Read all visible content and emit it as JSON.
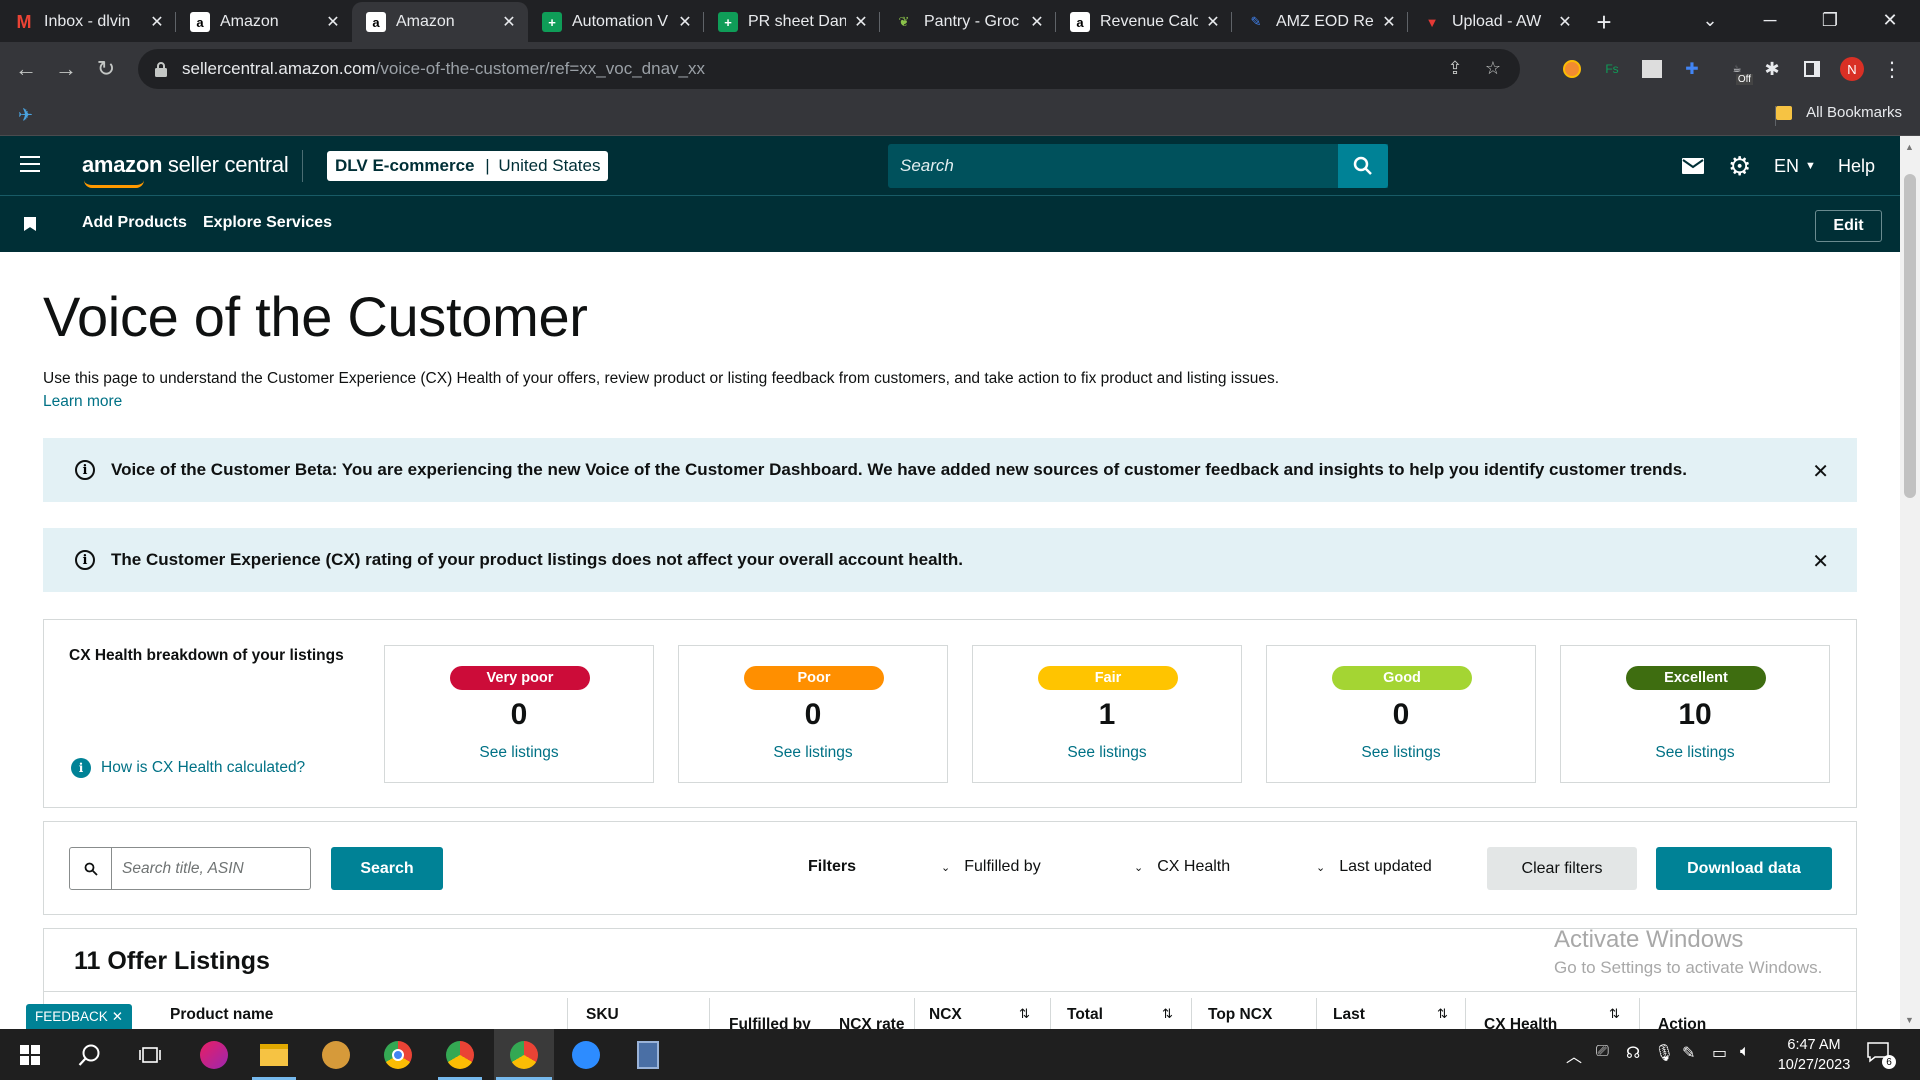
{
  "browser": {
    "tabs": [
      {
        "title": "Inbox - dlvin",
        "favicon": "gmail-icon",
        "active": false
      },
      {
        "title": "Amazon",
        "favicon": "amazon-icon",
        "active": false
      },
      {
        "title": "Amazon",
        "favicon": "amazon-icon",
        "active": true
      },
      {
        "title": "Automation V",
        "favicon": "sheets-icon",
        "active": false
      },
      {
        "title": "PR sheet Dan",
        "favicon": "sheets-icon",
        "active": false
      },
      {
        "title": "Pantry - Groc",
        "favicon": "pantry-icon",
        "active": false
      },
      {
        "title": "Revenue Calc",
        "favicon": "amazon-icon",
        "active": false
      },
      {
        "title": "AMZ EOD Re",
        "favicon": "pen-icon",
        "active": false
      },
      {
        "title": "Upload - AW",
        "favicon": "upload-icon",
        "active": false
      }
    ],
    "url_host": "sellercentral.amazon.com",
    "url_path": "/voice-of-the-customer/ref=xx_voc_dnav_xx",
    "profile_initial": "N",
    "extension_badge": "Off",
    "bookmarks_label": "All Bookmarks"
  },
  "header": {
    "logo_bold": "amazon",
    "logo_rest": " seller central",
    "account_name": "DLV E-commerce",
    "account_sep": " | ",
    "account_region": "United States",
    "search_placeholder": "Search",
    "language": "EN",
    "help_label": "Help"
  },
  "subnav": {
    "links": [
      "Add Products",
      "Explore Services"
    ],
    "edit_label": "Edit"
  },
  "page": {
    "title": "Voice of the Customer",
    "description": "Use this page to understand the Customer Experience (CX) Health of your offers, review product or listing feedback from customers, and take action to fix product and listing issues.",
    "learn_more": "Learn more",
    "alerts": [
      "Voice of the Customer Beta: You are experiencing the new Voice of the Customer Dashboard. We have added new sources of customer feedback and insights to help you identify customer trends.",
      "The Customer Experience (CX) rating of your product listings does not affect your overall account health."
    ]
  },
  "cx_health": {
    "heading": "CX Health breakdown of your listings",
    "how_link": "How is CX Health calculated?",
    "cards": [
      {
        "label": "Very poor",
        "count": "0",
        "link": "See listings",
        "color": "#cc0c39"
      },
      {
        "label": "Poor",
        "count": "0",
        "link": "See listings",
        "color": "#ff8f00"
      },
      {
        "label": "Fair",
        "count": "1",
        "link": "See listings",
        "color": "#ffc400"
      },
      {
        "label": "Good",
        "count": "0",
        "link": "See listings",
        "color": "#a4d533"
      },
      {
        "label": "Excellent",
        "count": "10",
        "link": "See listings",
        "color": "#3e6d10"
      }
    ]
  },
  "filters": {
    "search_placeholder": "Search title, ASIN",
    "search_button": "Search",
    "filters_label": "Filters",
    "dropdowns": [
      "Fulfilled by",
      "CX Health",
      "Last updated"
    ],
    "clear_button": "Clear filters",
    "download_button": "Download data"
  },
  "listings": {
    "title": "11 Offer Listings",
    "columns": [
      "Product name",
      "SKU",
      "Fulfilled by",
      "NCX rate",
      "NCX",
      "Total",
      "Top NCX",
      "Last",
      "CX Health",
      "Action"
    ]
  },
  "watermark": {
    "line1": "Activate Windows",
    "line2": "Go to Settings to activate Windows."
  },
  "feedback_label": "FEEDBACK",
  "taskbar": {
    "time": "6:47 AM",
    "date": "10/27/2023",
    "notification_count": "6"
  }
}
